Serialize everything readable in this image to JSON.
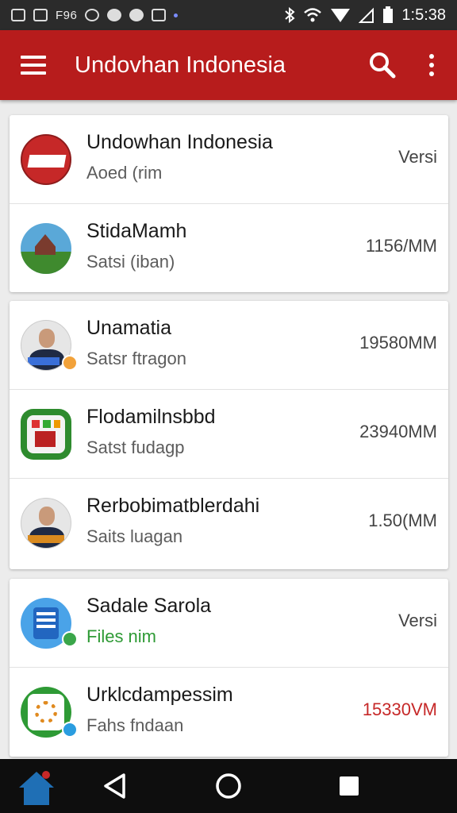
{
  "status_bar": {
    "left_text": "F96",
    "time": "1:5:38",
    "icons": [
      "image-icon",
      "photo-icon",
      "sync-icon",
      "whatsapp-icon",
      "chat-icon",
      "clipboard-icon",
      "dot-icon",
      "bluetooth-icon",
      "wifi-icon",
      "signal-icon",
      "battery-icon"
    ]
  },
  "app_bar": {
    "title": "Undovhan Indonesia",
    "background": "#b71c1c"
  },
  "cards": [
    {
      "rows": [
        {
          "title": "Undowhan Indonesia",
          "subtitle": "Aoed (rim",
          "meta": "Versi",
          "icon": "indonesia-flag-icon"
        },
        {
          "title": "StidaMamh",
          "subtitle": "Satsi (iban)",
          "meta": "1156/MM",
          "icon": "landscape-icon"
        }
      ]
    },
    {
      "rows": [
        {
          "title": "Unamatia",
          "subtitle": "Satsr ftragon",
          "meta": "19580MM",
          "icon": "person-avatar-icon"
        },
        {
          "title": "Flodamilnsbbd",
          "subtitle": "Satst fudagp",
          "meta": "23940MM",
          "icon": "app-grid-icon"
        },
        {
          "title": "Rerbobimatblerdahi",
          "subtitle": "Saits luagan",
          "meta": "1.50(MM",
          "icon": "person-avatar-icon"
        }
      ]
    },
    {
      "rows": [
        {
          "title": "Sadale Sarola",
          "subtitle": "Files nim",
          "meta": "Versi",
          "icon": "document-list-icon"
        },
        {
          "title": "Urklcdampessim",
          "subtitle": "Fahs fndaan",
          "meta": "15330VM",
          "icon": "green-sun-icon"
        }
      ]
    }
  ],
  "nav_bar": {
    "icons": [
      "home-icon",
      "back-icon",
      "home-circle-icon",
      "recents-icon"
    ]
  },
  "colors": {
    "accent": "#b71c1c",
    "green_text": "#2e9a35",
    "red_text": "#c62828"
  }
}
